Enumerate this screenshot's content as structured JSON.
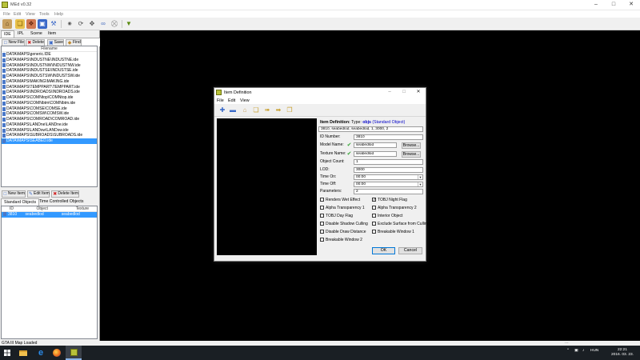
{
  "window": {
    "title": "MEd v0.32"
  },
  "menu": [
    "File",
    "Edit",
    "View",
    "Tools",
    "Help"
  ],
  "tabs": [
    "IDE",
    "IPL",
    "Scene",
    "Item"
  ],
  "file_buttons": {
    "new": "New File",
    "delete": "Delete",
    "save": "Save",
    "find": "Find"
  },
  "file_list": {
    "header": "Filename",
    "selected_index": 16,
    "items": [
      "DATA\\MAPS\\generic.IDE",
      "DATA\\MAPS\\INDUSTNE\\INDUSTNE.ide",
      "DATA\\MAPS\\INDUSTNW\\INDUSTNW.ide",
      "DATA\\MAPS\\INDUSTSE\\INDUSTSE.ide",
      "DATA\\MAPS\\INDUSTSW\\INDUSTSW.ide",
      "DATA\\MAPS\\MAKING\\MAKING.ide",
      "DATA\\MAPS\\TEMPPART\\TEMPPART.ide",
      "DATA\\MAPS\\INDROADS\\INDROADS.ide",
      "DATA\\MAPS\\COMNtop\\COMNtop.ide",
      "DATA\\MAPS\\COMNbtm\\COMNbtm.ide",
      "DATA\\MAPS\\COMSE\\COMSE.ide",
      "DATA\\MAPS\\COMSW\\COMSW.ide",
      "DATA\\MAPS\\COMROAD\\COMROAD.ide",
      "DATA\\MAPS\\LANDne\\LANDne.ide",
      "DATA\\MAPS\\LANDsw\\LANDsw.ide",
      "DATA\\MAPS\\SUBROADS\\SUBROADS.ide",
      "DATA\\MAPS\\SEABED.ide"
    ]
  },
  "item_buttons": {
    "new": "New Item",
    "edit": "Edit Item",
    "delete": "Delete Item"
  },
  "sub_tabs": [
    "Standard Objects",
    "Time Controlled Objects"
  ],
  "object_table": {
    "headers": [
      "ID",
      "Object",
      "Texture"
    ],
    "rows": [
      {
        "id": "3810",
        "object": "seabedlod",
        "texture": "seabedlod"
      }
    ]
  },
  "status": {
    "text": "GTA III Map Loaded"
  },
  "dialog": {
    "title": "Item Definition",
    "menu": [
      "File",
      "Edit",
      "View"
    ],
    "definition_label": "Item Definition:",
    "type_label": "Type:",
    "type_value": "objs",
    "type_desc": "(Standard Object)",
    "raw_line": "3810, seabedlod, seabedlod, 1, 3000, 2",
    "fields": {
      "id_label": "ID Number:",
      "id_value": "3810",
      "model_label": "Model Name:",
      "model_value": "seabedlod",
      "texture_label": "Texture Name:",
      "texture_value": "seabedlod",
      "count_label": "Object Count:",
      "count_value": "1",
      "lod_label": "LOD:",
      "lod_value": "3000",
      "timeon_label": "Time On:",
      "timeon_value": "00:00",
      "timeoff_label": "Time Off:",
      "timeoff_value": "00:00",
      "params_label": "Parameters:",
      "params_value": "2"
    },
    "browse": "Browse...",
    "flags": [
      {
        "label": "Renders Wet Effect",
        "checked": false
      },
      {
        "label": "TOBJ Night Flag",
        "checked": true
      },
      {
        "label": "Alpha Transparency 1",
        "checked": false
      },
      {
        "label": "Alpha Transparency 2",
        "checked": false
      },
      {
        "label": "TOBJ Day Flag",
        "checked": false
      },
      {
        "label": "Interior Object",
        "checked": false
      },
      {
        "label": "Disable Shadow Culling",
        "checked": false
      },
      {
        "label": "Exclude Surface from Culling",
        "checked": false
      },
      {
        "label": "Disable Draw Distance",
        "checked": false
      },
      {
        "label": "Breakable Window 1",
        "checked": false
      },
      {
        "label": "Breakable Window 2",
        "checked": false
      }
    ],
    "ok": "OK",
    "cancel": "Cancel"
  },
  "taskbar": {
    "tray_lang": "HUN",
    "time": "22:21",
    "date": "2016. 03. 23."
  }
}
